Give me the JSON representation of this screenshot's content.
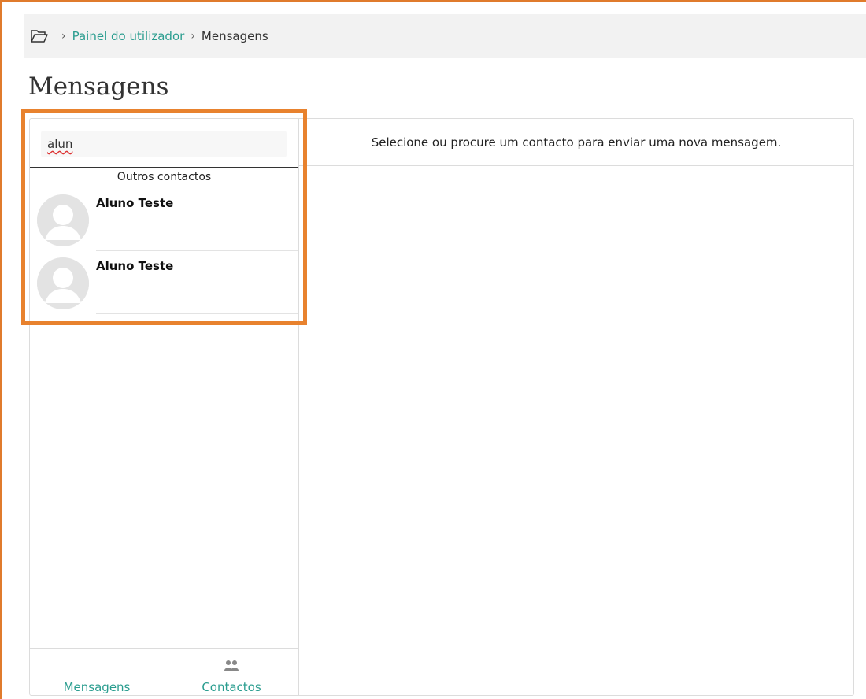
{
  "breadcrumb": {
    "items": [
      {
        "label": "Painel do utilizador"
      },
      {
        "label": "Mensagens"
      }
    ],
    "separator": "›"
  },
  "page": {
    "title": "Mensagens"
  },
  "search": {
    "value": "alun"
  },
  "contacts_section": {
    "title": "Outros contactos",
    "items": [
      {
        "name": "Aluno Teste"
      },
      {
        "name": "Aluno Teste"
      }
    ]
  },
  "conversation": {
    "empty_message": "Selecione ou procure um contacto para enviar uma nova mensagem."
  },
  "footer_tabs": {
    "messages_label": "Mensagens",
    "contacts_label": "Contactos"
  },
  "colors": {
    "accent": "#2a9d8f",
    "highlight": "#e8822e"
  },
  "icons": {
    "breadcrumb_home": "folder-open-icon",
    "avatar": "default-user-avatar-icon",
    "contacts_tab": "users-icon"
  }
}
